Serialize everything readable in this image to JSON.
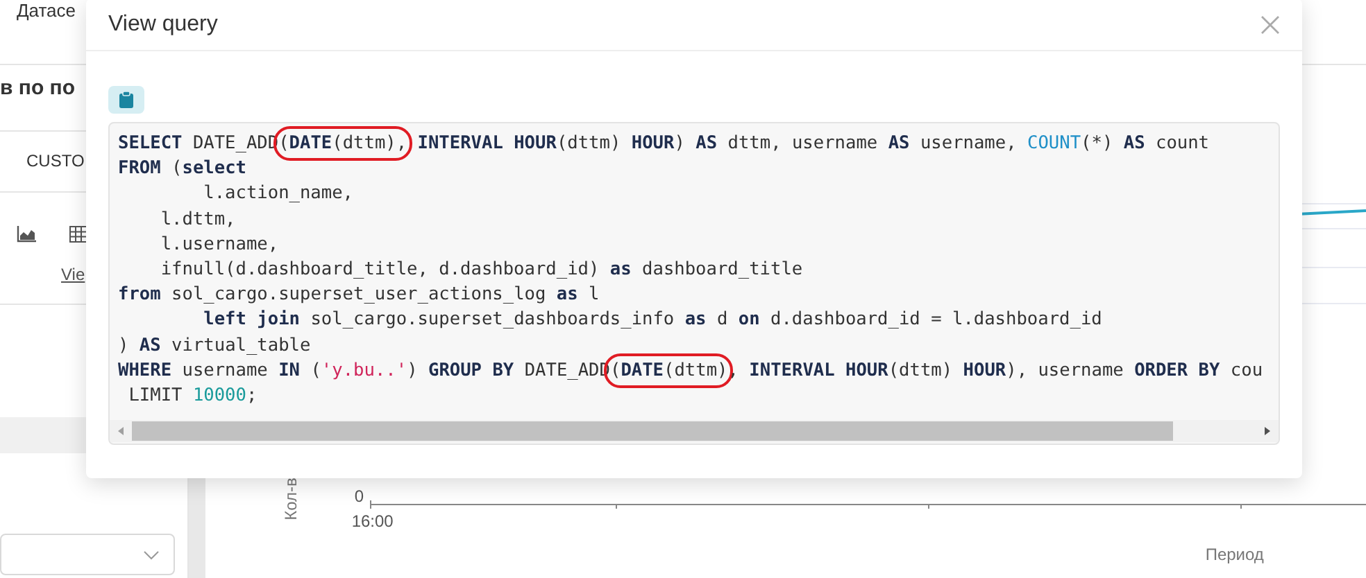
{
  "background": {
    "header_text": "Датасе",
    "page_title": "в по по",
    "tab": "CUSTO",
    "link": "Vie",
    "chart": {
      "ylabel": "Кол-в",
      "ytick": "0",
      "xtick": "16:00",
      "xlabel": "Период"
    }
  },
  "dialog": {
    "title": "View query",
    "code_lines": [
      [
        {
          "text": "SELECT",
          "kind": "kw"
        },
        {
          "text": " DATE_ADD",
          "kind": "p"
        },
        {
          "kind": "ring",
          "parts": [
            {
              "text": "(",
              "kind": "p"
            },
            {
              "text": "DATE",
              "kind": "kw"
            },
            {
              "text": "(dttm),",
              "kind": "p"
            }
          ]
        },
        {
          "text": " INTERVAL HOUR",
          "kind": "kw"
        },
        {
          "text": "(dttm) ",
          "kind": "p"
        },
        {
          "text": "HOUR",
          "kind": "kw"
        },
        {
          "text": ") ",
          "kind": "p"
        },
        {
          "text": "AS",
          "kind": "kw"
        },
        {
          "text": " dttm, username ",
          "kind": "p"
        },
        {
          "text": "AS",
          "kind": "kw"
        },
        {
          "text": " username, ",
          "kind": "p"
        },
        {
          "text": "COUNT",
          "kind": "fn"
        },
        {
          "text": "(*) ",
          "kind": "p"
        },
        {
          "text": "AS",
          "kind": "kw"
        },
        {
          "text": " count",
          "kind": "p"
        }
      ],
      [
        {
          "text": "FROM",
          "kind": "kw"
        },
        {
          "text": " (",
          "kind": "p"
        },
        {
          "text": "select",
          "kind": "kw"
        }
      ],
      [
        {
          "text": "        l.action_name,",
          "kind": "p"
        }
      ],
      [
        {
          "text": "    l.dttm,",
          "kind": "p"
        }
      ],
      [
        {
          "text": "    l.username,",
          "kind": "p"
        }
      ],
      [
        {
          "text": "    ifnull(d.dashboard_title, d.dashboard_id) ",
          "kind": "p"
        },
        {
          "text": "as",
          "kind": "kw"
        },
        {
          "text": " dashboard_title",
          "kind": "p"
        }
      ],
      [
        {
          "text": "from",
          "kind": "kw"
        },
        {
          "text": " sol_cargo.superset_user_actions_log ",
          "kind": "p"
        },
        {
          "text": "as",
          "kind": "kw"
        },
        {
          "text": " l",
          "kind": "p"
        }
      ],
      [
        {
          "text": "        left join",
          "kind": "kw"
        },
        {
          "text": " sol_cargo.superset_dashboards_info ",
          "kind": "p"
        },
        {
          "text": "as",
          "kind": "kw"
        },
        {
          "text": " d ",
          "kind": "p"
        },
        {
          "text": "on",
          "kind": "kw"
        },
        {
          "text": " d.dashboard_id = l.dashboard_id",
          "kind": "p"
        }
      ],
      [
        {
          "text": ") ",
          "kind": "p"
        },
        {
          "text": "AS",
          "kind": "kw"
        },
        {
          "text": " virtual_table",
          "kind": "p"
        }
      ],
      [
        {
          "text": "WHERE",
          "kind": "kw"
        },
        {
          "text": " username ",
          "kind": "p"
        },
        {
          "text": "IN",
          "kind": "kw"
        },
        {
          "text": " (",
          "kind": "p"
        },
        {
          "text": "'y.bu..'",
          "kind": "str"
        },
        {
          "text": ") ",
          "kind": "p"
        },
        {
          "text": "GROUP BY",
          "kind": "kw"
        },
        {
          "text": " DATE_ADD",
          "kind": "p"
        },
        {
          "kind": "ring",
          "parts": [
            {
              "text": "(",
              "kind": "p"
            },
            {
              "text": "DATE",
              "kind": "kw"
            },
            {
              "text": "(dttm)",
              "kind": "p"
            }
          ]
        },
        {
          "text": ", ",
          "kind": "p"
        },
        {
          "text": "INTERVAL HOUR",
          "kind": "kw"
        },
        {
          "text": "(dttm) ",
          "kind": "p"
        },
        {
          "text": "HOUR",
          "kind": "kw"
        },
        {
          "text": "), username ",
          "kind": "p"
        },
        {
          "text": "ORDER BY",
          "kind": "kw"
        },
        {
          "text": " cou",
          "kind": "p"
        }
      ],
      [
        {
          "text": " LIMIT ",
          "kind": "p"
        },
        {
          "text": "10000",
          "kind": "num"
        },
        {
          "text": ";",
          "kind": "p"
        }
      ]
    ]
  }
}
